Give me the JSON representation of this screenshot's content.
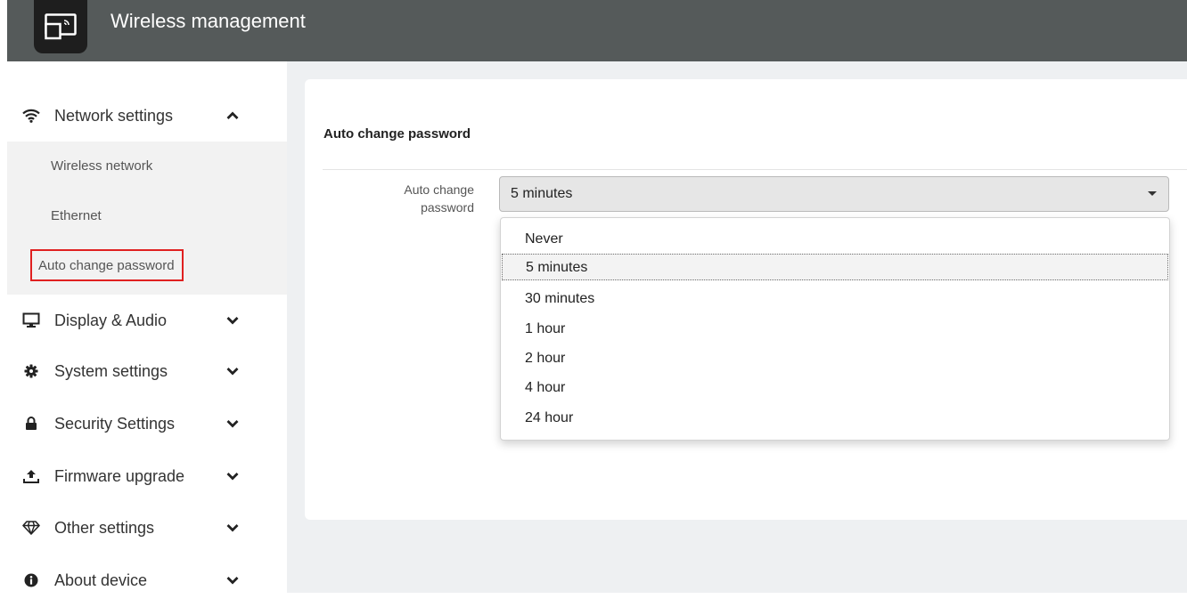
{
  "app": {
    "title": "Wireless management"
  },
  "sidebar": {
    "groups": [
      {
        "label": "Network settings",
        "icon": "wifi-icon",
        "expanded": true
      },
      {
        "label": "Display & Audio",
        "icon": "monitor-icon",
        "expanded": false
      },
      {
        "label": "System settings",
        "icon": "gear-icon",
        "expanded": false
      },
      {
        "label": "Security Settings",
        "icon": "lock-icon",
        "expanded": false
      },
      {
        "label": "Firmware upgrade",
        "icon": "upload-icon",
        "expanded": false
      },
      {
        "label": "Other settings",
        "icon": "diamond-icon",
        "expanded": false
      },
      {
        "label": "About device",
        "icon": "info-icon",
        "expanded": false
      }
    ],
    "network_submenu": [
      {
        "label": "Wireless network"
      },
      {
        "label": "Ethernet"
      },
      {
        "label": "Auto change password",
        "active": true
      }
    ]
  },
  "main": {
    "card_title": "Auto change password",
    "field": {
      "label": "Auto change password",
      "selected": "5 minutes",
      "options": [
        "Never",
        "5 minutes",
        "30 minutes",
        "1 hour",
        "2 hour",
        "4 hour",
        "24 hour"
      ]
    }
  },
  "colors": {
    "header_bg": "#555a5a",
    "highlight_border": "#e02020",
    "main_bg": "#eef0f2"
  }
}
